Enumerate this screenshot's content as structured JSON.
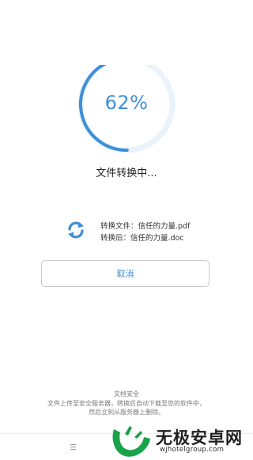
{
  "progress": {
    "percent": 62,
    "label": "62%",
    "arc_color": "#3d8fd6",
    "track_color": "#eaf3fb"
  },
  "status": {
    "text": "文件转换中..."
  },
  "file_info": {
    "icon": "sync-icon",
    "source_line": "转换文件：信任的力量.pdf",
    "target_line": "转换后：信任的力量.doc"
  },
  "actions": {
    "cancel_label": "取消"
  },
  "security": {
    "title": "文档安全",
    "description_line1": "文件上传至安全服务器，转换后自动下载至您的软件中，",
    "description_line2": "然后立刻从服务器上删除。"
  },
  "bottom_bar": {
    "menu_icon": "menu-icon"
  },
  "watermark": {
    "title": "无极安卓网",
    "url": "wjhotelgroup.com",
    "logo_color": "#1aa34a"
  }
}
